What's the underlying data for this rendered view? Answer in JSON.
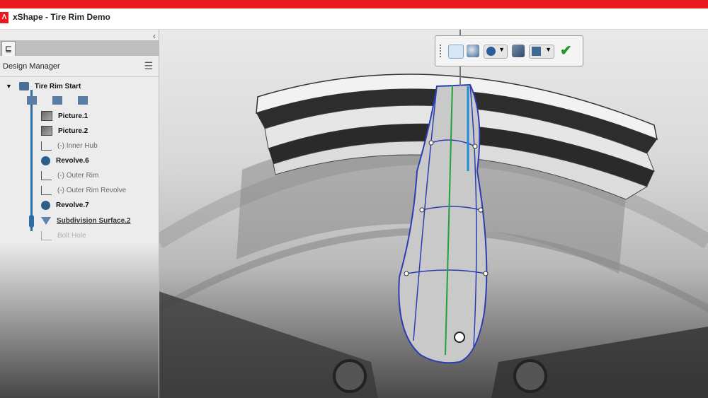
{
  "window": {
    "title": "xShape - Tire Rim Demo",
    "logo_letter": "Λ"
  },
  "panel": {
    "collapse_icon": "‹",
    "title": "Design Manager",
    "menu_icon": "☰",
    "tree_tab_icon": "tree-icon",
    "root": "Tire Rim Start",
    "items": [
      {
        "label": "Picture.1",
        "icon": "picture-icon",
        "style": "normal"
      },
      {
        "label": "Picture.2",
        "icon": "picture-icon",
        "style": "normal"
      },
      {
        "label": "(-)   Inner Hub",
        "icon": "sketch-icon",
        "style": "muted"
      },
      {
        "label": "Revolve.6",
        "icon": "revolve-icon",
        "style": "bold"
      },
      {
        "label": "(-)   Outer Rim",
        "icon": "sketch-icon",
        "style": "muted"
      },
      {
        "label": "(-)   Outer Rim Revolve",
        "icon": "sketch-icon",
        "style": "muted"
      },
      {
        "label": "Revolve.7",
        "icon": "revolve-icon",
        "style": "bold"
      },
      {
        "label": "Subdivision Surface.2",
        "icon": "subdivision-icon",
        "style": "active"
      },
      {
        "label": "Bolt Hole",
        "icon": "sketch-icon",
        "style": "muted"
      }
    ]
  },
  "toolbar": {
    "tools": [
      "display-mode-icon",
      "shading-icon",
      "sphere-view-icon",
      "render-icon",
      "cube-view-icon",
      "accept-check-icon"
    ]
  },
  "colors": {
    "accent_red": "#e8191f",
    "tree_blue": "#2f6da8",
    "cage_blue": "#2b3db0",
    "axis_green": "#22a03a"
  }
}
